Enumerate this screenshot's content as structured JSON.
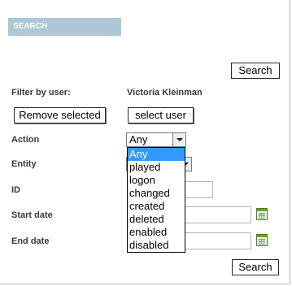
{
  "search_panel": {
    "header": "SEARCH",
    "top_search_button": "Search",
    "bottom_search_button": "Search"
  },
  "filter_user": {
    "label": "Filter by user:",
    "user_name": "Victoria Kleinman",
    "remove_button": "Remove selected",
    "select_button": "select user"
  },
  "action": {
    "label": "Action",
    "selected": "Any",
    "options": [
      "Any",
      "played",
      "logon",
      "changed",
      "created",
      "deleted",
      "enabled",
      "disabled"
    ]
  },
  "entity": {
    "label": "Entity"
  },
  "id_field": {
    "label": "ID",
    "value": ""
  },
  "start_date": {
    "label": "Start date",
    "value": ""
  },
  "end_date": {
    "label": "End date",
    "value": ""
  },
  "colors": {
    "header_bg": "#aec6d6",
    "selected_option": "#3399ff",
    "calendar_icon": "#6f9b3e"
  },
  "icons": {
    "dropdown": "chevron-down-icon",
    "calendar": "calendar-icon"
  }
}
